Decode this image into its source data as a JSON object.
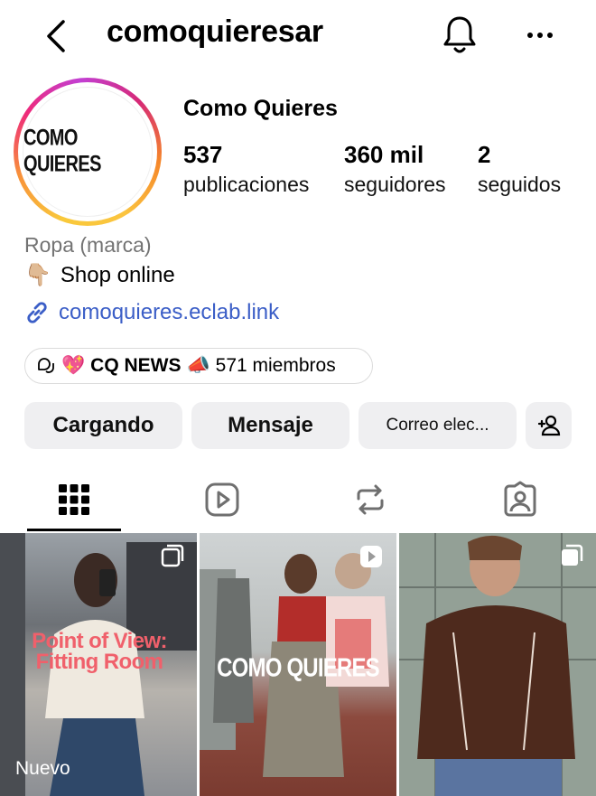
{
  "header": {
    "username": "comoquieresar"
  },
  "profile": {
    "avatar_text": "COMO QUIERES",
    "display_name": "Como Quieres",
    "stats": [
      {
        "value": "537",
        "label": "publicaciones"
      },
      {
        "value": "360 mil",
        "label": "seguidores"
      },
      {
        "value": "2",
        "label": "seguidos"
      }
    ],
    "category": "Ropa (marca)",
    "bio_emoji": "👇🏼",
    "bio_text": "Shop online",
    "link": "comoquieres.eclab.link"
  },
  "channel": {
    "emoji_left": "💖",
    "name": "CQ NEWS",
    "emoji_right": "📣",
    "members": "571 miembros"
  },
  "actions": {
    "follow_label": "Cargando",
    "message_label": "Mensaje",
    "email_label": "Correo elec..."
  },
  "grid": {
    "tiles": [
      {
        "overlay": "Point of View: Fitting Room",
        "tag": "Nuevo"
      },
      {
        "overlay": "COMO QUIERES"
      },
      {
        "overlay": ""
      }
    ]
  },
  "colors": {
    "link": "#3b5ec7",
    "button_bg": "#efeff1",
    "muted": "#737373"
  }
}
